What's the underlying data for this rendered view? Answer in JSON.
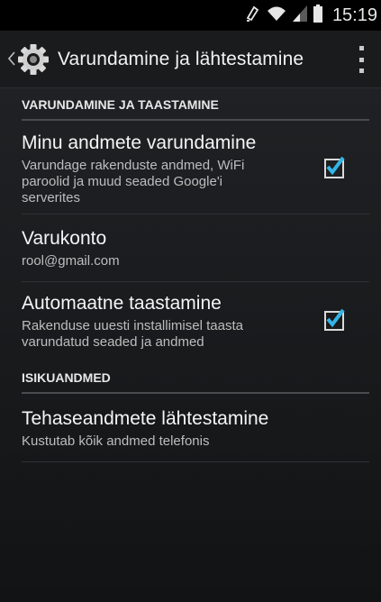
{
  "status_bar": {
    "time": "15:19",
    "icons": [
      "rotation-lock-icon",
      "wifi-icon",
      "signal-icon",
      "battery-icon"
    ]
  },
  "app_bar": {
    "title": "Varundamine ja lähtestamine",
    "icon": "gear-icon",
    "menu_icon": "overflow-menu-icon"
  },
  "sections": [
    {
      "header": "VARUNDAMINE JA TAASTAMINE"
    },
    {
      "header": "ISIKUANDMED"
    }
  ],
  "items": [
    {
      "title": "Minu andmete varundamine",
      "summary_lines": [
        "Varundage rakenduste andmed, WiFi",
        "paroolid ja muud seaded Google'i",
        "serverites"
      ],
      "checked": true
    },
    {
      "title": "Varukonto",
      "summary_lines": [
        "rool@gmail.com"
      ]
    },
    {
      "title": "Automaatne taastamine",
      "summary_lines": [
        "Rakenduse uuesti installimisel taasta",
        "varundatud seaded ja andmed"
      ],
      "checked": true
    },
    {
      "title": "Tehaseandmete lähtestamine",
      "summary_lines": [
        "Kustutab kõik andmed telefonis"
      ]
    }
  ],
  "colors": {
    "accent": "#33b5e5",
    "background": "#1f2124",
    "divider": "#494b4e"
  }
}
